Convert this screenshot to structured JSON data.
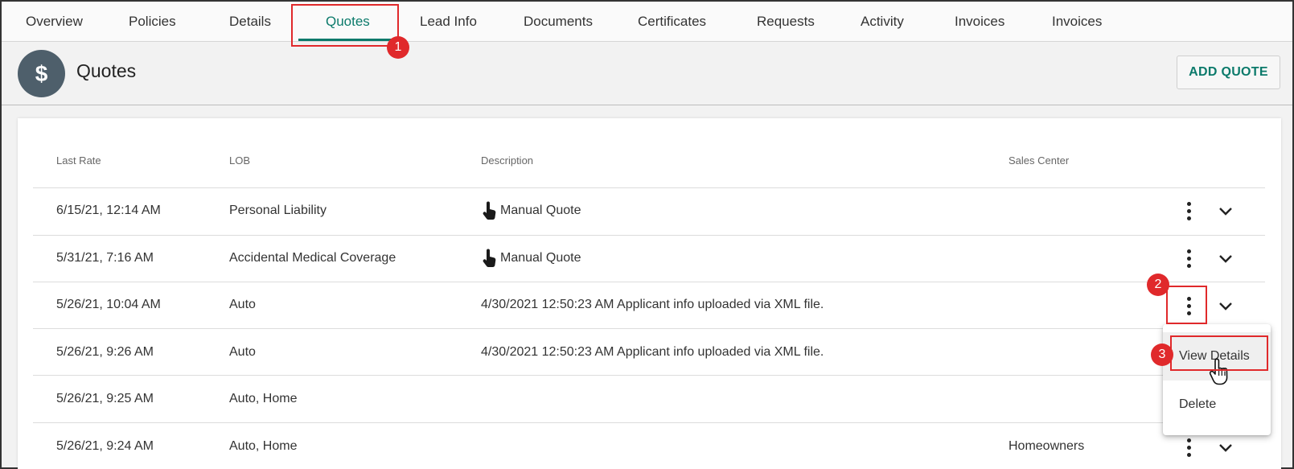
{
  "tabs": [
    {
      "label": "Overview"
    },
    {
      "label": "Policies"
    },
    {
      "label": "Details"
    },
    {
      "label": "Quotes",
      "active": true
    },
    {
      "label": "Lead Info"
    },
    {
      "label": "Documents"
    },
    {
      "label": "Certificates"
    },
    {
      "label": "Requests"
    },
    {
      "label": "Activity"
    },
    {
      "label": "Invoices"
    },
    {
      "label": "Invoices"
    }
  ],
  "header": {
    "avatar_symbol": "$",
    "title": "Quotes",
    "add_button": "ADD QUOTE"
  },
  "table": {
    "columns": [
      "Last Rate",
      "LOB",
      "Description",
      "Sales Center"
    ],
    "rows": [
      {
        "last_rate": "6/15/21, 12:14 AM",
        "lob": "Personal Liability",
        "description": "Manual Quote",
        "manual_icon": true,
        "sales_center": ""
      },
      {
        "last_rate": "5/31/21, 7:16 AM",
        "lob": "Accidental Medical Coverage",
        "description": "Manual Quote",
        "manual_icon": true,
        "sales_center": ""
      },
      {
        "last_rate": "5/26/21, 10:04 AM",
        "lob": "Auto",
        "description": "4/30/2021 12:50:23 AM Applicant info uploaded via XML file.",
        "manual_icon": false,
        "sales_center": ""
      },
      {
        "last_rate": "5/26/21, 9:26 AM",
        "lob": "Auto",
        "description": "4/30/2021 12:50:23 AM Applicant info uploaded via XML file.",
        "manual_icon": false,
        "sales_center": ""
      },
      {
        "last_rate": "5/26/21, 9:25 AM",
        "lob": "Auto, Home",
        "description": "",
        "manual_icon": false,
        "sales_center": ""
      },
      {
        "last_rate": "5/26/21, 9:24 AM",
        "lob": "Auto, Home",
        "description": "",
        "manual_icon": false,
        "sales_center": "Homeowners"
      }
    ]
  },
  "context_menu": {
    "items": [
      {
        "label": "View Details"
      },
      {
        "label": "Delete"
      }
    ]
  },
  "annotations": {
    "step1": "1",
    "step2": "2",
    "step3": "3"
  },
  "colors": {
    "accent": "#0b7a6b",
    "annotation": "#e0292b",
    "avatar_bg": "#4e5f6b"
  }
}
